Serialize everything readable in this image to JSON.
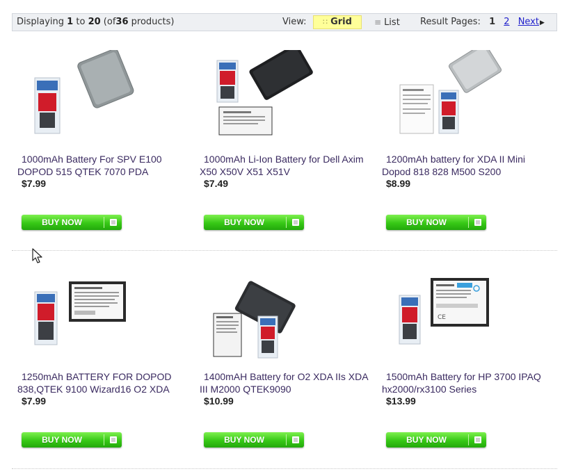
{
  "toolbar": {
    "displaying_prefix": "Displaying",
    "range_start": "1",
    "to": "to",
    "range_end": "20",
    "of_prefix": "(of",
    "total": "36",
    "products_suffix": "products)",
    "view_label": "View:",
    "grid_label": "Grid",
    "grid_icon": "grid-icon",
    "list_label": "List",
    "list_icon": "list-icon",
    "result_pages_label": "Result Pages:",
    "current_page": "1",
    "page_2": "2",
    "next_label": "Next"
  },
  "buy_now_label": "BUY NOW",
  "products": [
    {
      "title": "1000mAh Battery For SPV E100 DOPOD 515 QTEK 7070 PDA",
      "price": "$7.99",
      "image": "grey-battery-with-package"
    },
    {
      "title": "1000mAh Li-Ion Battery for Dell Axim X50 X50V X51 X51V",
      "price": "$7.49",
      "image": "black-battery-with-package"
    },
    {
      "title": "1200mAh battery for XDA II Mini Dopod 818 828 M500 S200",
      "price": "$8.99",
      "image": "silver-battery-with-label"
    },
    {
      "title": "1250mAh BATTERY FOR DOPOD 838,QTEK 9100 Wizard16 O2 XDA",
      "price": "$7.99",
      "image": "labeled-battery-with-package"
    },
    {
      "title": "1400mAH Battery for O2 XDA IIs XDA III M2000 QTEK9090",
      "price": "$10.99",
      "image": "black-battery-with-package"
    },
    {
      "title": "1500mAh Battery for HP 3700 IPAQ hx2000/rx3100 Series",
      "price": "$13.99",
      "image": "labeled-battery-with-package"
    }
  ],
  "colors": {
    "buy_button": "#37c816",
    "grid_highlight": "#ffff99",
    "link": "#2222cc",
    "title_text": "#3a2a60"
  }
}
